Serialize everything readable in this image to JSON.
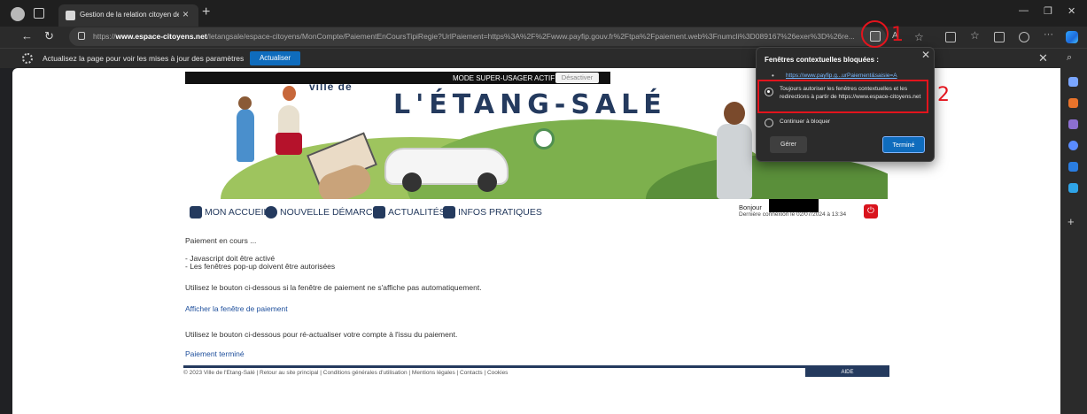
{
  "browser": {
    "tab_title": "Gestion de la relation citoyen de",
    "url_prefix": "https://",
    "url_domain": "www.espace-citoyens.net",
    "url_rest": "/letangsale/espace-citoyens/MonCompte/PaiementEnCoursTipiRegie?UrlPaiement=https%3A%2F%2Fwww.payfip.gouv.fr%2Ftpa%2Fpaiement.web%3Fnumcli%3D089167%26exer%3D%26re...",
    "annotation_1": "1",
    "annotation_2": "2"
  },
  "infobar": {
    "text": "Actualisez la page pour voir les mises à jour des paramètres",
    "button": "Actualiser"
  },
  "page": {
    "admin_text": "MODE SUPER-USAGER ACTIF",
    "admin_button": "Désactiver",
    "banner_top": "ville de",
    "banner_title": "L'ÉTANG-SALÉ",
    "nav": [
      "MON ACCUEIL",
      "NOUVELLE DÉMARCHE",
      "ACTUALITÉS",
      "INFOS PRATIQUES"
    ],
    "bonjour": "Bonjour",
    "derniere_connexion": "Dernière connexion le 02/07/2024 à 13:34",
    "content": {
      "paiement_en_cours": "Paiement en cours ...",
      "req1": "- Javascript doit être activé",
      "req2": "- Les fenêtres pop-up doivent être autorisées",
      "info1": "Utilisez le bouton ci-dessous si la fenêtre de paiement ne s'affiche pas automatiquement.",
      "link1": "Afficher la fenêtre de paiement",
      "info2": "Utilisez le bouton ci-dessous pour ré-actualiser votre compte à l'issu du paiement.",
      "link2": "Paiement terminé"
    },
    "footer": "© 2023 Ville de l'Etang-Salé | Retour au site principal | Conditions générales d'utilisation | Mentions légales | Contacts | Cookies",
    "footer_aide": "AIDE"
  },
  "popup": {
    "title": "Fenêtres contextuelles bloquées :",
    "link": "https://www.payfip.g...urPaiement&saisie=A",
    "option1": "Toujours autoriser les fenêtres contextuelles et les redirections à partir de https://www.espace-citoyens.net",
    "option2": "Continuer à bloquer",
    "selected": "option1",
    "button_manage": "Gérer",
    "button_done": "Terminé"
  },
  "colors": {
    "accent": "#0f6cbd",
    "annotation": "#e3141d",
    "brand_blue": "#243a5e"
  }
}
